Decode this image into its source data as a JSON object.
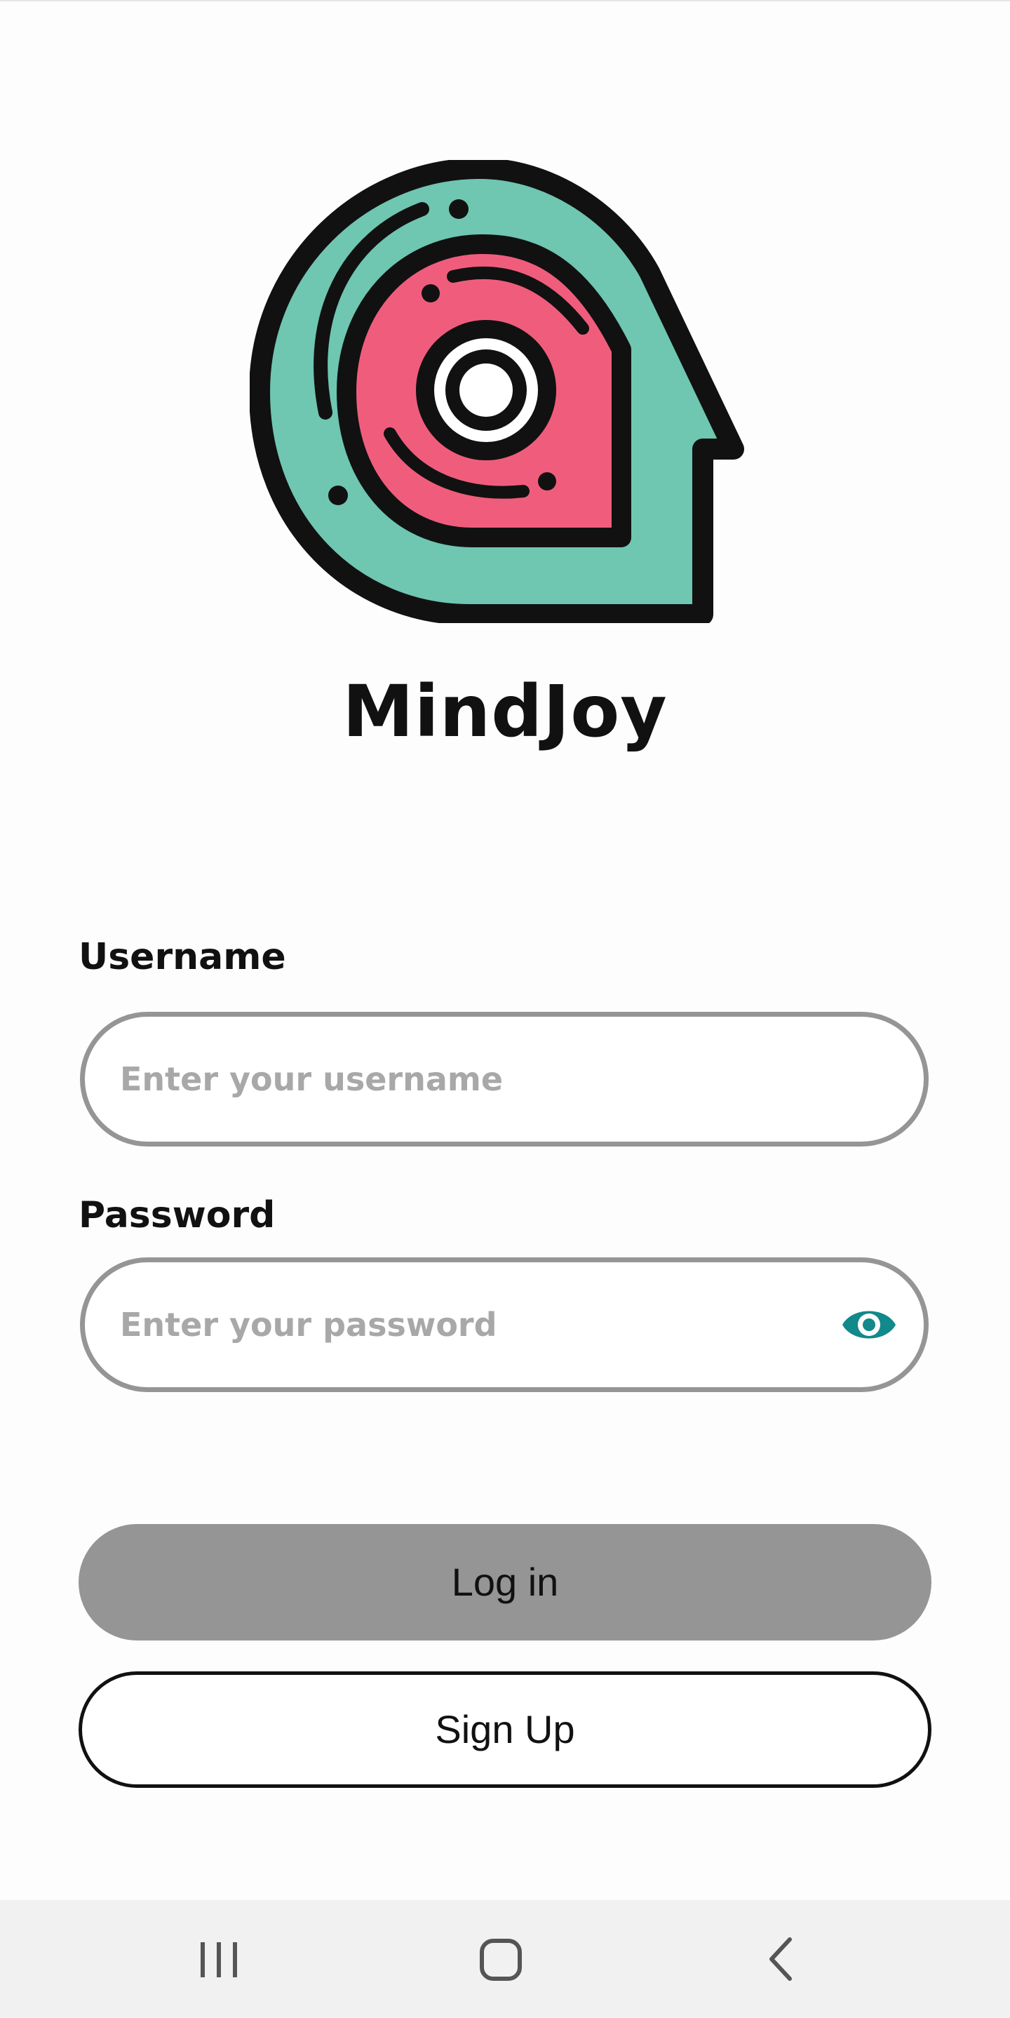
{
  "app": {
    "title": "MindJoy",
    "logo_icon": "mind-head-icon"
  },
  "form": {
    "username": {
      "label": "Username",
      "placeholder": "Enter your username",
      "value": ""
    },
    "password": {
      "label": "Password",
      "placeholder": "Enter your password",
      "value": "",
      "toggle_icon": "eye-icon"
    }
  },
  "actions": {
    "login_label": "Log in",
    "signup_label": "Sign Up"
  },
  "navbar": {
    "items": [
      {
        "name": "recent-apps",
        "icon": "recent-apps-icon"
      },
      {
        "name": "home",
        "icon": "home-icon"
      },
      {
        "name": "back",
        "icon": "back-icon"
      }
    ]
  },
  "colors": {
    "logo_teal": "#6fc6b1",
    "logo_pink": "#f05d7c",
    "eye_teal": "#12898a",
    "button_gray": "#959595",
    "field_border": "#959595",
    "navbar_bg": "#f1f1f1"
  }
}
